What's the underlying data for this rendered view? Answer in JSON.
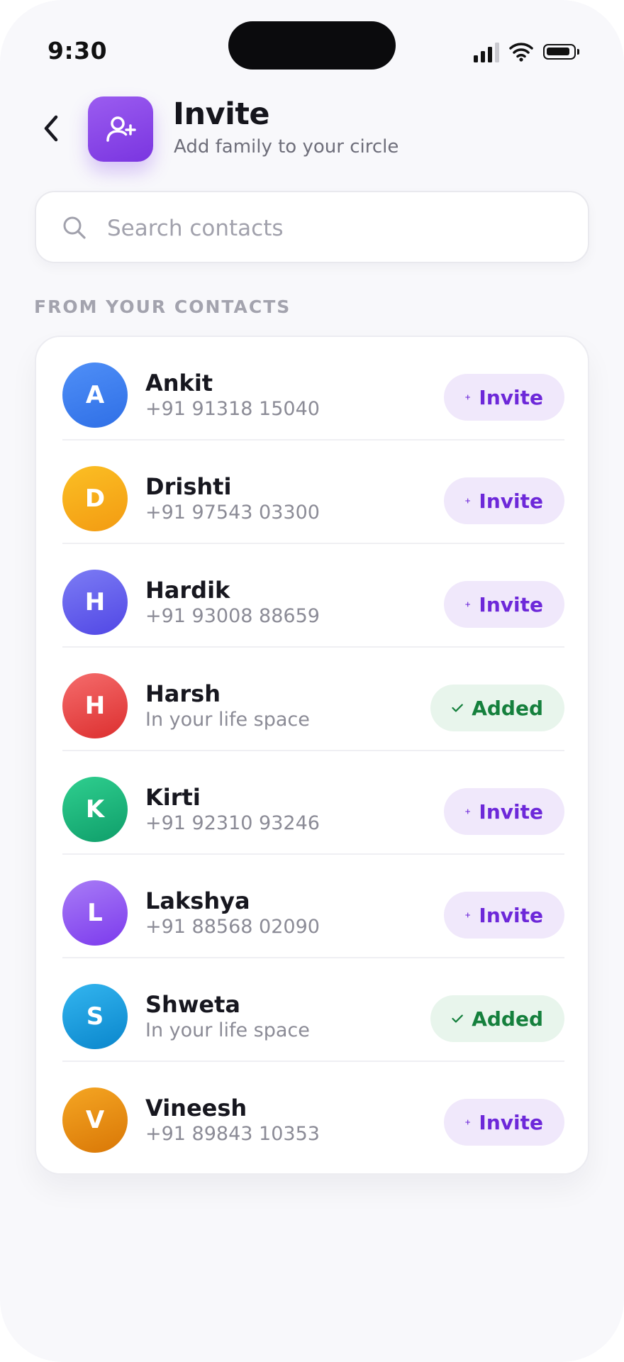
{
  "status_bar": {
    "time": "9:30"
  },
  "header": {
    "back_icon": "chevron-left-icon",
    "app_icon": "user-plus-icon",
    "title": "Invite",
    "subtitle": "Add family to your circle",
    "accent_color": "#7c3aed"
  },
  "search": {
    "placeholder": "Search contacts",
    "value": ""
  },
  "section": {
    "label": "FROM YOUR CONTACTS"
  },
  "contacts": [
    {
      "initial": "A",
      "name": "Ankit",
      "detail": "+91 91318 15040",
      "status": "invite",
      "action_label": "Invite",
      "colors": [
        "#4f8ff7",
        "#2f6fe6"
      ]
    },
    {
      "initial": "D",
      "name": "Drishti",
      "detail": "+91 97543 03300",
      "status": "invite",
      "action_label": "Invite",
      "colors": [
        "#fbbf24",
        "#f39b12"
      ]
    },
    {
      "initial": "H",
      "name": "Hardik",
      "detail": "+91 93008 88659",
      "status": "invite",
      "action_label": "Invite",
      "colors": [
        "#7c7cf4",
        "#5147e5"
      ]
    },
    {
      "initial": "H",
      "name": "Harsh",
      "detail": "In your life space",
      "status": "added",
      "action_label": "Added",
      "colors": [
        "#f56c6c",
        "#dc2f2f"
      ]
    },
    {
      "initial": "K",
      "name": "Kirti",
      "detail": "+91 92310 93246",
      "status": "invite",
      "action_label": "Invite",
      "colors": [
        "#2fcf8f",
        "#0f9e6a"
      ]
    },
    {
      "initial": "L",
      "name": "Lakshya",
      "detail": "+91 88568 02090",
      "status": "invite",
      "action_label": "Invite",
      "colors": [
        "#a87cf6",
        "#7c3aed"
      ]
    },
    {
      "initial": "S",
      "name": "Shweta",
      "detail": "In your life space",
      "status": "added",
      "action_label": "Added",
      "colors": [
        "#33b5ef",
        "#0a86cc"
      ]
    },
    {
      "initial": "V",
      "name": "Vineesh",
      "detail": "+91 89843 10353",
      "status": "invite",
      "action_label": "Invite",
      "colors": [
        "#f5a623",
        "#d97706"
      ]
    }
  ]
}
